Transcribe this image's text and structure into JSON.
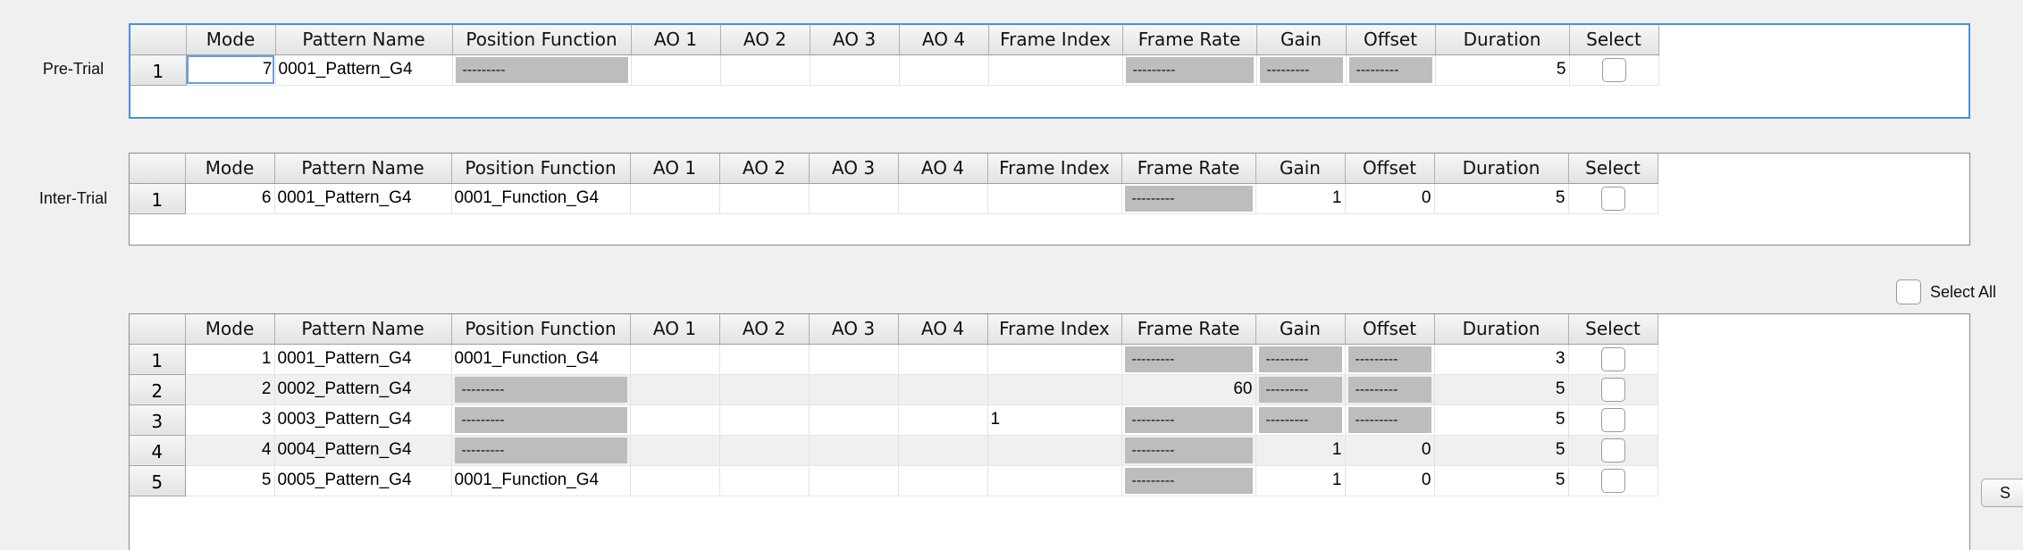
{
  "columns": [
    "Mode",
    "Pattern Name",
    "Position Function",
    "AO 1",
    "AO 2",
    "AO 3",
    "AO 4",
    "Frame Index",
    "Frame Rate",
    "Gain",
    "Offset",
    "Duration",
    "Select"
  ],
  "disabled_text": "---------",
  "pretrial": {
    "label": "Pre-Trial",
    "rows": [
      {
        "num": "1",
        "mode": "7",
        "pattern": "0001_Pattern_G4",
        "position": "---------",
        "ao1": "",
        "ao2": "",
        "ao3": "",
        "ao4": "",
        "frame_index": "",
        "frame_rate": "---------",
        "gain": "---------",
        "offset": "---------",
        "duration": "5"
      }
    ]
  },
  "intertrial": {
    "label": "Inter-Trial",
    "rows": [
      {
        "num": "1",
        "mode": "6",
        "pattern": "0001_Pattern_G4",
        "position": "0001_Function_G4",
        "ao1": "",
        "ao2": "",
        "ao3": "",
        "ao4": "",
        "frame_index": "",
        "frame_rate": "---------",
        "gain": "1",
        "offset": "0",
        "duration": "5"
      }
    ]
  },
  "block": {
    "select_all_label": "Select All",
    "rows": [
      {
        "num": "1",
        "mode": "1",
        "pattern": "0001_Pattern_G4",
        "position": "0001_Function_G4",
        "ao1": "",
        "ao2": "",
        "ao3": "",
        "ao4": "",
        "frame_index": "",
        "frame_rate": "---------",
        "gain": "---------",
        "offset": "---------",
        "duration": "3"
      },
      {
        "num": "2",
        "mode": "2",
        "pattern": "0002_Pattern_G4",
        "position": "---------",
        "ao1": "",
        "ao2": "",
        "ao3": "",
        "ao4": "",
        "frame_index": "",
        "frame_rate": "60",
        "gain": "---------",
        "offset": "---------",
        "duration": "5"
      },
      {
        "num": "3",
        "mode": "3",
        "pattern": "0003_Pattern_G4",
        "position": "---------",
        "ao1": "",
        "ao2": "",
        "ao3": "",
        "ao4": "",
        "frame_index": "1",
        "frame_rate": "---------",
        "gain": "---------",
        "offset": "---------",
        "duration": "5"
      },
      {
        "num": "4",
        "mode": "4",
        "pattern": "0004_Pattern_G4",
        "position": "---------",
        "ao1": "",
        "ao2": "",
        "ao3": "",
        "ao4": "",
        "frame_index": "",
        "frame_rate": "---------",
        "gain": "1",
        "offset": "0",
        "duration": "5"
      },
      {
        "num": "5",
        "mode": "5",
        "pattern": "0005_Pattern_G4",
        "position": "0001_Function_G4",
        "ao1": "",
        "ao2": "",
        "ao3": "",
        "ao4": "",
        "frame_index": "",
        "frame_rate": "---------",
        "gain": "1",
        "offset": "0",
        "duration": "5"
      }
    ]
  },
  "side_button_label": "S",
  "colors": {
    "active_border": "#4a90d9",
    "disabled_cell": "#bdbdbd",
    "alt_row": "#f0f0f0",
    "background": "#f0f0f0"
  }
}
